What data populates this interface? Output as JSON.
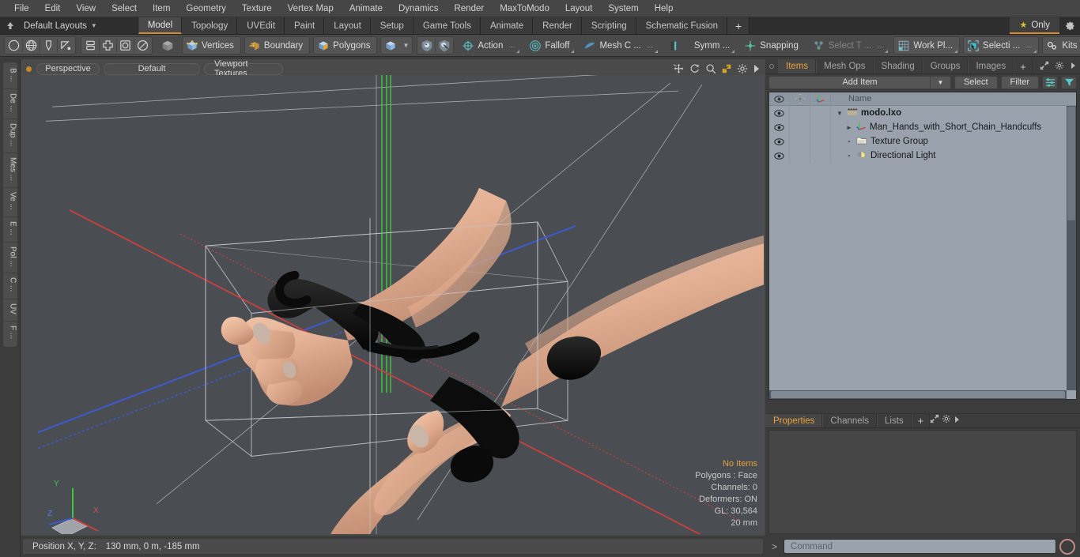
{
  "menubar": {
    "items": [
      "File",
      "Edit",
      "View",
      "Select",
      "Item",
      "Geometry",
      "Texture",
      "Vertex Map",
      "Animate",
      "Dynamics",
      "Render",
      "MaxToModo",
      "Layout",
      "System",
      "Help"
    ]
  },
  "layoutbar": {
    "home_icon": "home-arrow-icon",
    "layout_label": "Default Layouts",
    "tabs": [
      {
        "label": "Model",
        "active": true
      },
      {
        "label": "Topology",
        "active": false
      },
      {
        "label": "UVEdit",
        "active": false
      },
      {
        "label": "Paint",
        "active": false
      },
      {
        "label": "Layout",
        "active": false
      },
      {
        "label": "Setup",
        "active": false
      },
      {
        "label": "Game Tools",
        "active": false
      },
      {
        "label": "Animate",
        "active": false
      },
      {
        "label": "Render",
        "active": false
      },
      {
        "label": "Scripting",
        "active": false
      },
      {
        "label": "Schematic Fusion",
        "active": false
      }
    ],
    "add_tab_label": "+",
    "only_label": "Only",
    "only_icon": "star-icon",
    "gear_icon": "gear-icon",
    "active_accent": "#d98b28"
  },
  "toolbar": {
    "shape_tools": [
      "circle-icon",
      "globe-icon",
      "pen-icon",
      "curve-icon"
    ],
    "mesh_tools": [
      "stack-icon",
      "plus-shape-icon",
      "square-circle-icon",
      "ellipse-icon"
    ],
    "cube_icon": "grey-cube-icon",
    "selection_modes": [
      {
        "label": "Vertices",
        "icon": "vertices-cube-icon"
      },
      {
        "label": "Boundary",
        "icon": "boundary-cube-icon"
      },
      {
        "label": "Polygons",
        "icon": "polygons-cube-icon"
      }
    ],
    "mode_dropdown_icon": "cube-dropdown-icon",
    "shield_tools": [
      "shield-sphere-icon",
      "shield-arrow-icon"
    ],
    "action_label": "Action",
    "action_icon": "action-center-icon",
    "falloff_label": "Falloff",
    "falloff_icon": "falloff-icon",
    "meshc_label": "Mesh C ...",
    "meshc_icon": "mesh-constraint-icon",
    "symm_label": "Symm ...",
    "symm_icon": "symmetry-icon",
    "snapping_label": "Snapping",
    "snapping_icon": "snapping-icon",
    "selecttype_label": "Select T ...",
    "selecttype_icon": "select-through-icon",
    "workplane_label": "Work Pl...",
    "workplane_icon": "workplane-icon",
    "selection_label": "Selecti ...",
    "selection_icon": "selection-set-icon",
    "kits_label": "Kits",
    "kits_icon": "kits-gears-icon",
    "app_icons": [
      "modo-cube-icon",
      "unreal-icon"
    ]
  },
  "left_strip": {
    "tabs": [
      "B ...",
      "De ...",
      "Dup ...",
      "Mes ...",
      "Ve ...",
      "E ...",
      "Pol ...",
      "C ...",
      "UV",
      "F ..."
    ]
  },
  "viewport": {
    "dot_color": "#c8882a",
    "chips": [
      "Perspective",
      "Default",
      "Viewport Textures"
    ],
    "tool_icons": [
      "pan-icon",
      "rotate-icon",
      "zoom-icon",
      "fit-icon",
      "viewport-gear-icon",
      "viewport-arrow-icon"
    ],
    "background_color": "#4a4e52",
    "axis_gizmo": {
      "x_label": "X",
      "y_label": "Y",
      "z_label": "Z",
      "x_color": "#c84040",
      "y_color": "#3ec83e",
      "z_color": "#3c5ad0"
    },
    "stats": [
      {
        "text": "No Items",
        "highlight": true
      },
      {
        "text": "Polygons : Face",
        "highlight": false
      },
      {
        "text": "Channels: 0",
        "highlight": false
      },
      {
        "text": "Deformers: ON",
        "highlight": false
      },
      {
        "text": "GL: 30,564",
        "highlight": false
      },
      {
        "text": "20 mm",
        "highlight": false
      }
    ]
  },
  "right_panel": {
    "tabs": [
      {
        "label": "Items",
        "active": true
      },
      {
        "label": "Mesh Ops",
        "active": false
      },
      {
        "label": "Shading",
        "active": false
      },
      {
        "label": "Groups",
        "active": false
      },
      {
        "label": "Images",
        "active": false
      }
    ],
    "add_tab_label": "+",
    "expand_icon": "expand-arrows-icon",
    "gear_icon": "panel-gear-icon",
    "more_icon": "panel-more-icon",
    "add_item_label": "Add Item",
    "select_label": "Select",
    "filter_label": "Filter",
    "list_icon": "list-options-icon",
    "funnel_icon": "funnel-icon",
    "tree_columns": {
      "eye": "eye-icon",
      "lock": "lock-icon",
      "transform": "axis-icon",
      "name": "Name"
    },
    "tree_rows": [
      {
        "label": "modo.lxo",
        "icon": "scene-clapper-icon",
        "depth": 0,
        "twisty": "down",
        "bold": true
      },
      {
        "label": "Man_Hands_with_Short_Chain_Handcuffs",
        "icon": "mesh-axis-icon",
        "depth": 1,
        "twisty": "right",
        "bold": false
      },
      {
        "label": "Texture Group",
        "icon": "texture-group-icon",
        "depth": 1,
        "twisty": "none",
        "bold": false
      },
      {
        "label": "Directional Light",
        "icon": "directional-light-icon",
        "depth": 1,
        "twisty": "none",
        "bold": false
      }
    ],
    "properties_tabs": [
      {
        "label": "Properties",
        "active": true
      },
      {
        "label": "Channels",
        "active": false
      },
      {
        "label": "Lists",
        "active": false
      }
    ],
    "properties_add_label": "+"
  },
  "statusbar": {
    "position_label": "Position X, Y, Z:",
    "position_value": "130 mm, 0 m, -185 mm",
    "command_prompt": ">",
    "command_placeholder": "Command",
    "record_icon": "record-icon"
  }
}
